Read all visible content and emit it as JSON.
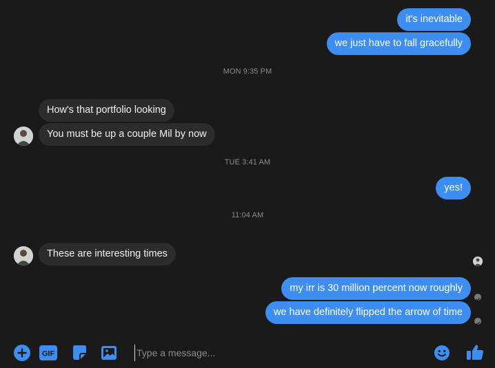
{
  "messages": {
    "m1": "it's inevitable",
    "m2": "we just have to fall gracefully",
    "m3": "How's that portfolio looking",
    "m4": "You must be up a couple Mil by now",
    "m5": "yes!",
    "m6": "These are interesting times",
    "m7": "my irr is 30 million percent now roughly",
    "m8": "we have definitely flipped the arrow of time"
  },
  "timestamps": {
    "t1": "MON 9:35 PM",
    "t2": "TUE 3:41 AM",
    "t3": "11:04 AM"
  },
  "composer": {
    "placeholder": "Type a message...",
    "gif_label": "GIF"
  },
  "colors": {
    "outgoing_bubble": "#3d8ef0",
    "incoming_bubble": "#2c2c2e",
    "background": "#1a1a1b",
    "accent": "#3d8ef0"
  },
  "icons": [
    "plus-circle-icon",
    "gif-icon",
    "sticker-icon",
    "image-icon",
    "emoji-icon",
    "thumbs-up-icon",
    "seen-check-icon"
  ]
}
